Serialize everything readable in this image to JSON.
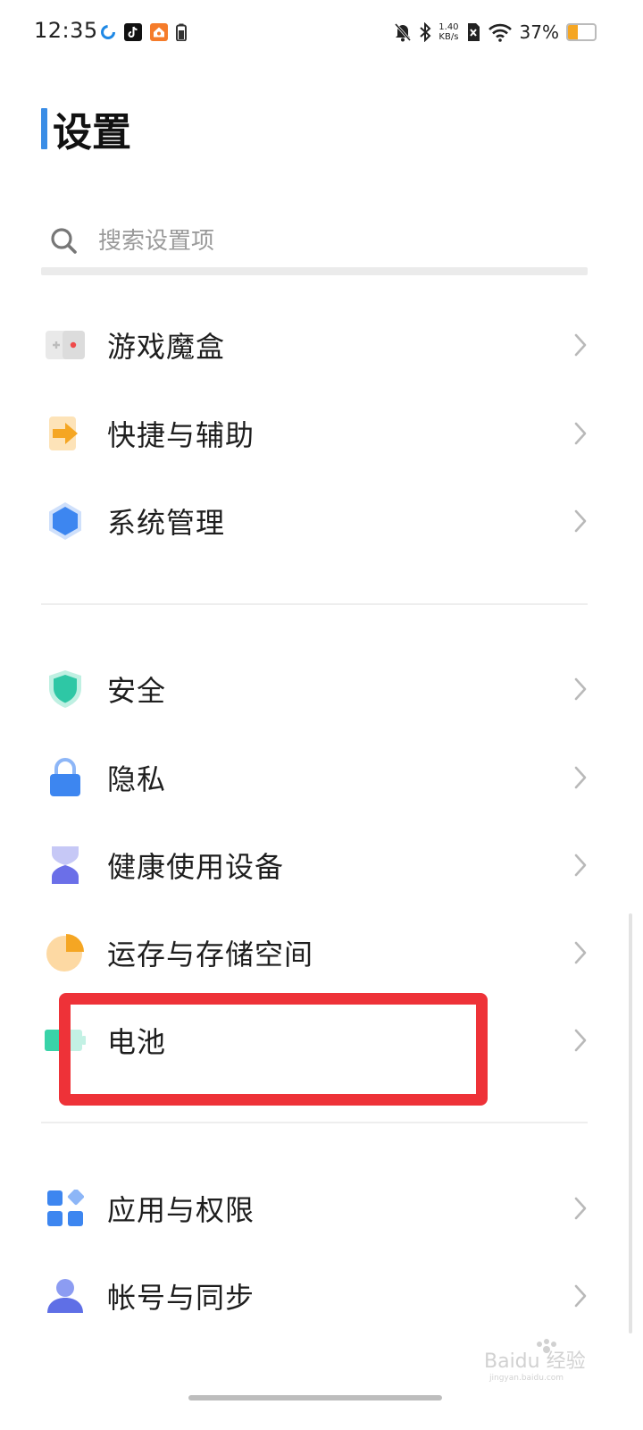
{
  "status_bar": {
    "time": "12:35",
    "net_speed_value": "1.40",
    "net_speed_unit": "KB/s",
    "battery_percent_text": "37%",
    "battery_level": 0.37
  },
  "header": {
    "title": "设置"
  },
  "search": {
    "placeholder": "搜索设置项"
  },
  "sections": [
    {
      "items": [
        {
          "label": "游戏魔盒",
          "icon": "game-box-icon"
        },
        {
          "label": "快捷与辅助",
          "icon": "shortcut-arrow-icon"
        },
        {
          "label": "系统管理",
          "icon": "system-hexagon-icon"
        }
      ]
    },
    {
      "items": [
        {
          "label": "安全",
          "icon": "shield-icon"
        },
        {
          "label": "隐私",
          "icon": "lock-icon"
        },
        {
          "label": "健康使用设备",
          "icon": "hourglass-icon"
        },
        {
          "label": "运存与存储空间",
          "icon": "storage-pie-icon"
        },
        {
          "label": "电池",
          "icon": "battery-icon"
        }
      ]
    },
    {
      "items": [
        {
          "label": "应用与权限",
          "icon": "apps-grid-icon"
        },
        {
          "label": "帐号与同步",
          "icon": "account-person-icon"
        }
      ]
    }
  ],
  "colors": {
    "title_accent": "#3a8de6",
    "highlight_box": "#ee3238",
    "system_icon": "#3d86f0",
    "shield_icon": "#2ec7a5",
    "lock_icon": "#3d86f0",
    "hourglass_icon": "#6b6fe8",
    "storage_icon": "#f5a623",
    "battery_icon": "#38d3a8",
    "shortcut_icon": "#f5a623"
  },
  "watermark": {
    "text": "Baidu 经验",
    "subtext": "jingyan.baidu.com"
  }
}
